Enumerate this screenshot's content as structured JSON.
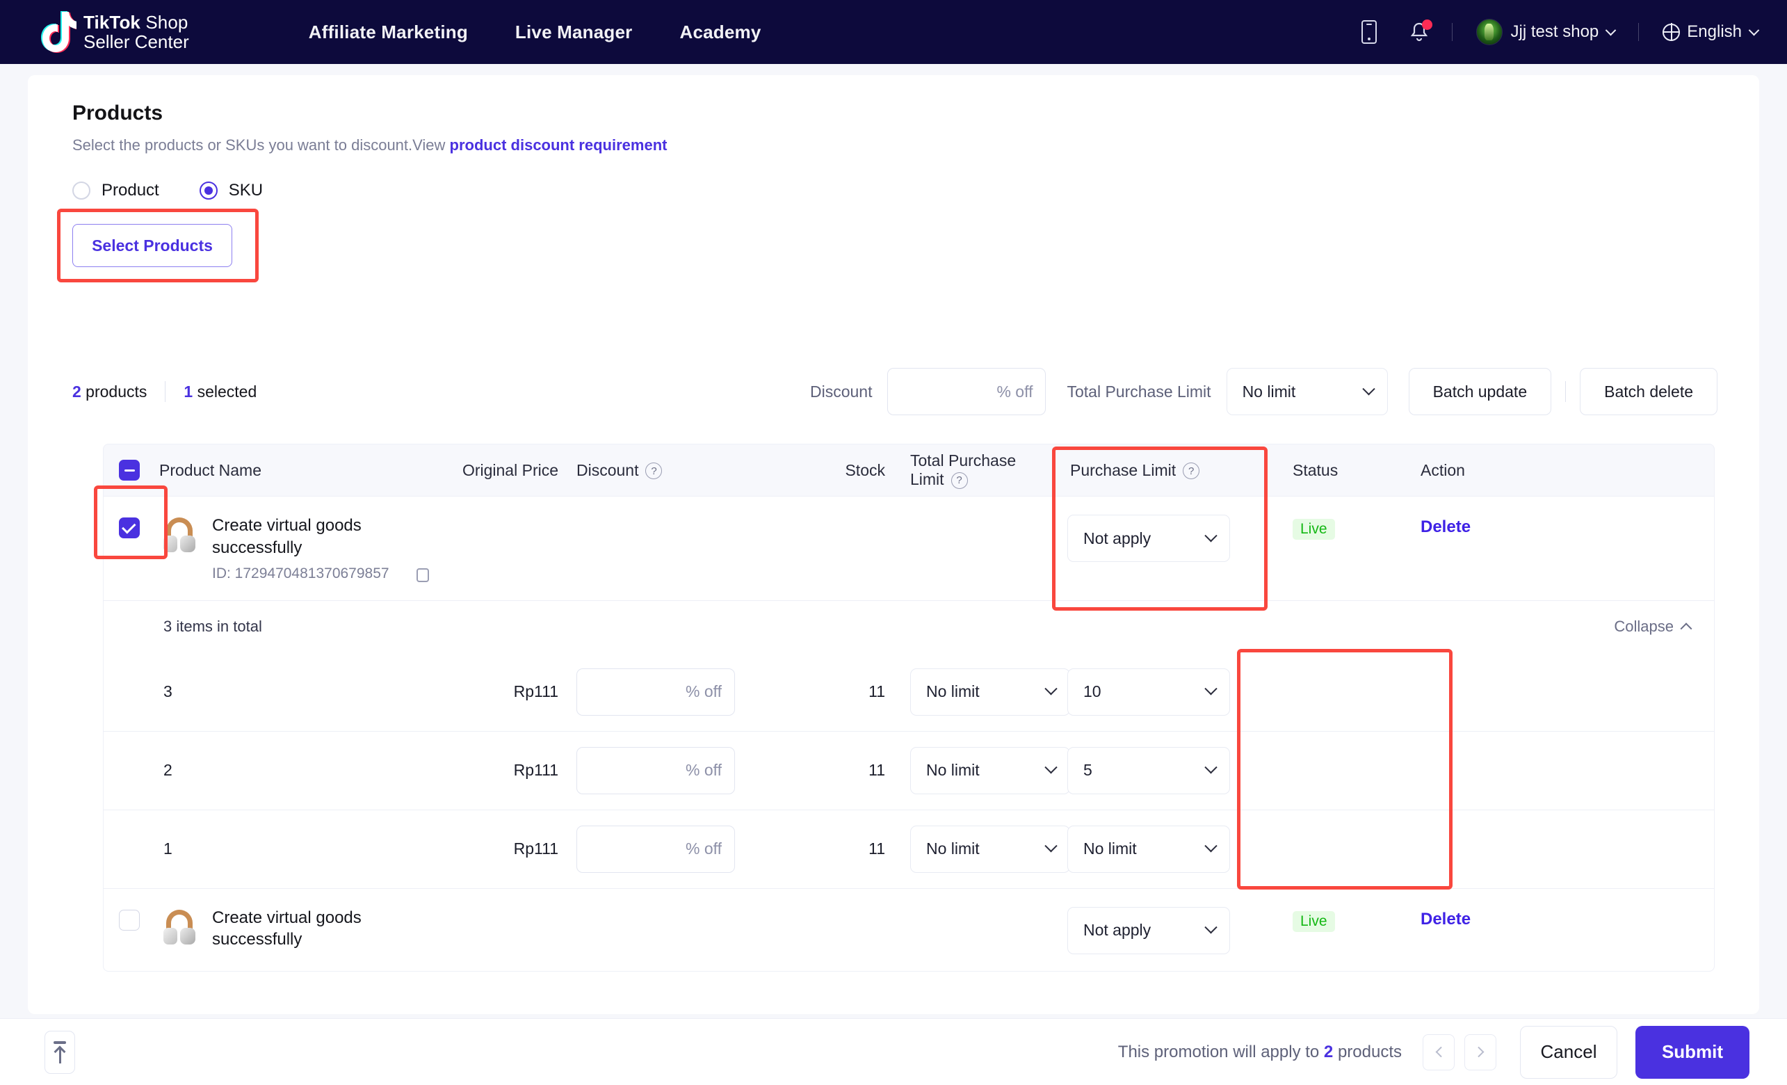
{
  "header": {
    "logo_line1_bold": "TikTok",
    "logo_line1_rest": " Shop",
    "logo_line2": "Seller Center",
    "nav": [
      {
        "label": "Affiliate Marketing"
      },
      {
        "label": "Live Manager"
      },
      {
        "label": "Academy"
      }
    ],
    "shop_name": "Jjj test shop",
    "language": "English"
  },
  "products_section": {
    "title": "Products",
    "subtitle_text": "Select the products or SKUs you want to discount.View ",
    "subtitle_link": "product discount requirement",
    "radio_product": "Product",
    "radio_sku": "SKU",
    "selected_radio": "SKU",
    "select_products_button": "Select Products"
  },
  "toolbar": {
    "product_count": "2",
    "product_count_label": " products",
    "selected_count": "1",
    "selected_count_label": " selected",
    "discount_label": "Discount",
    "discount_value": "",
    "discount_suffix": "% off",
    "total_purchase_limit_label": "Total Purchase Limit",
    "total_purchase_limit_value": "No limit",
    "batch_update": "Batch update",
    "batch_delete": "Batch delete"
  },
  "table": {
    "columns": {
      "product_name": "Product Name",
      "original_price": "Original Price",
      "discount": "Discount",
      "stock": "Stock",
      "total_purchase_limit": "Total Purchase Limit",
      "purchase_limit": "Purchase Limit",
      "status": "Status",
      "action": "Action"
    },
    "products": [
      {
        "name": "Create virtual goods successfully",
        "id_label": "ID: 1729470481370679857",
        "checked": true,
        "purchase_limit": "Not apply",
        "status": "Live",
        "action": "Delete",
        "items_in_total": "3 items in total",
        "collapse_label": "Collapse",
        "skus": [
          {
            "no": "3",
            "price": "Rp111",
            "discount_value": "",
            "discount_suffix": "% off",
            "stock": "11",
            "total_purchase_limit": "No limit",
            "purchase_limit": "10",
            "enabled": true
          },
          {
            "no": "2",
            "price": "Rp111",
            "discount_value": "",
            "discount_suffix": "% off",
            "stock": "11",
            "total_purchase_limit": "No limit",
            "purchase_limit": "5",
            "enabled": true
          },
          {
            "no": "1",
            "price": "Rp111",
            "discount_value": "",
            "discount_suffix": "% off",
            "stock": "11",
            "total_purchase_limit": "No limit",
            "purchase_limit": "No limit",
            "enabled": true
          }
        ]
      },
      {
        "name": "Create virtual goods successfully",
        "checked": false,
        "purchase_limit": "Not apply",
        "status": "Live",
        "action": "Delete"
      }
    ]
  },
  "footer": {
    "promotion_text_pre": "This promotion will apply to ",
    "promotion_count": "2",
    "promotion_text_post": " products",
    "cancel": "Cancel",
    "submit": "Submit"
  },
  "colors": {
    "nav_bg": "#0d0a3c",
    "accent": "#4a31e0",
    "highlight": "#f9473e",
    "status_live": "#14b814"
  }
}
